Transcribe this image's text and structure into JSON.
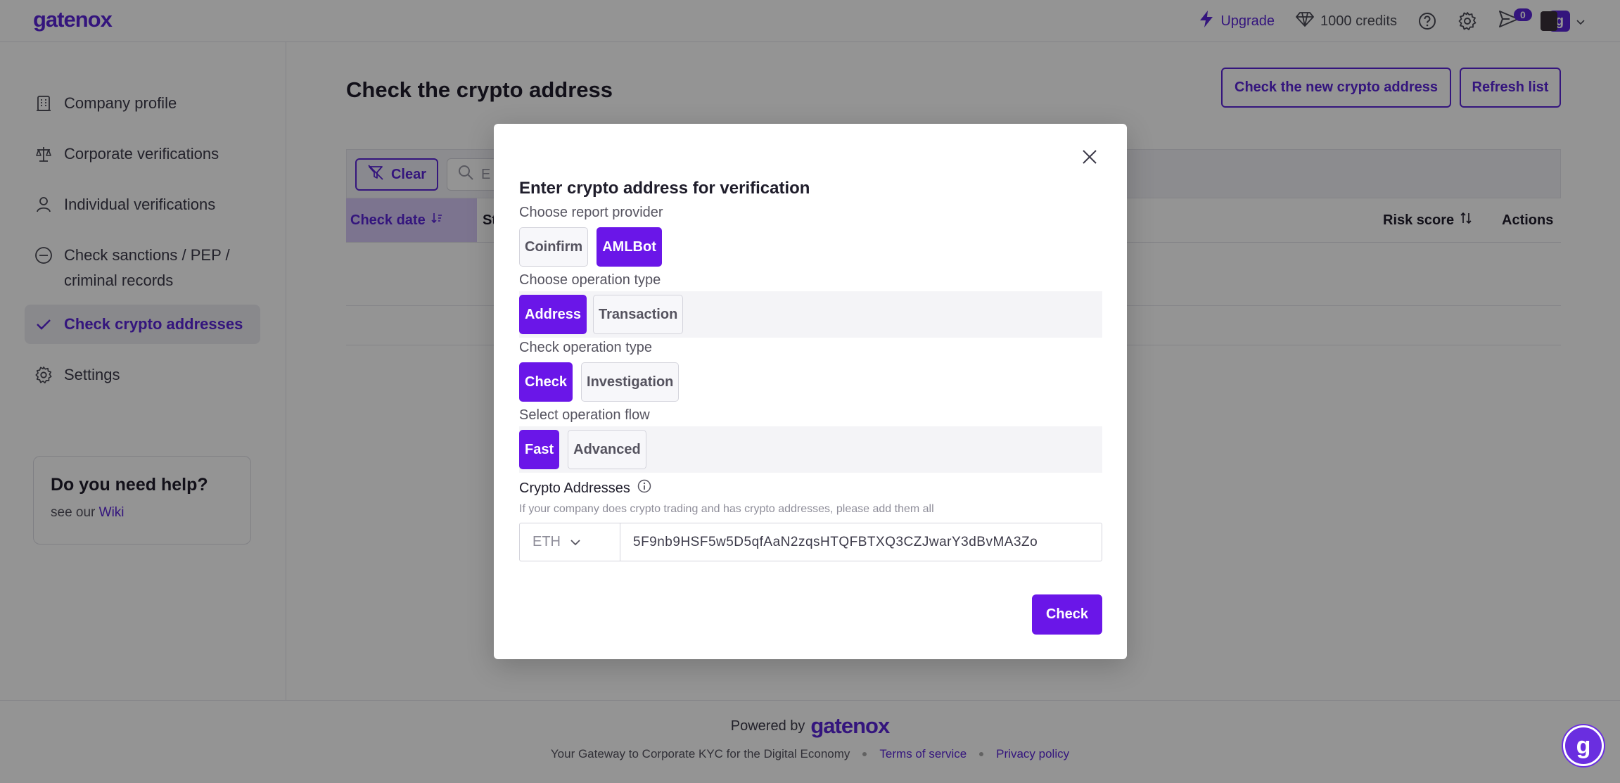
{
  "brand": {
    "logo": "gatenox",
    "accent": "#5a25d8"
  },
  "topnav": {
    "upgrade": "Upgrade",
    "credits": "1000 credits",
    "notifications_count": "0",
    "avatar_letter": "g"
  },
  "sidebar": {
    "items": [
      {
        "label": "Company profile",
        "icon": "building-icon"
      },
      {
        "label": "Corporate verifications",
        "icon": "scales-icon"
      },
      {
        "label": "Individual verifications",
        "icon": "user-icon"
      },
      {
        "label": "Check sanctions / PEP / criminal records",
        "icon": "minus-circle-icon"
      },
      {
        "label": "Check crypto addresses",
        "icon": "check-icon",
        "active": true
      },
      {
        "label": "Settings",
        "icon": "gear-icon"
      }
    ],
    "help": {
      "title": "Do you need help?",
      "text": "see our",
      "link": "Wiki"
    }
  },
  "main": {
    "title": "Check the crypto address",
    "new_button": "Check the new crypto address",
    "refresh_button": "Refresh list",
    "clear_button": "Clear",
    "search_placeholder": "E",
    "columns": {
      "check_date": "Check date",
      "status": "St",
      "risk_score": "Risk score",
      "actions": "Actions"
    }
  },
  "modal": {
    "title": "Enter crypto address for verification",
    "provider_label": "Choose report provider",
    "providers": [
      "Coinfirm",
      "AMLBot"
    ],
    "provider_selected": "AMLBot",
    "op_type_label": "Choose operation type",
    "op_types": [
      "Address",
      "Transaction"
    ],
    "op_type_selected": "Address",
    "check_type_label": "Check operation type",
    "check_types": [
      "Check",
      "Investigation"
    ],
    "check_type_selected": "Check",
    "flow_label": "Select operation flow",
    "flows": [
      "Fast",
      "Advanced"
    ],
    "flow_selected": "Fast",
    "addresses_label": "Crypto Addresses",
    "addresses_hint": "If your company does crypto trading and has crypto addresses, please add them all",
    "currency": "ETH",
    "address_value": "5F9nb9HSF5w5D5qfAaN2zqsHTQFBTXQ3CZJwarY3dBvMA3Zo",
    "submit": "Check"
  },
  "footer": {
    "powered_by": "Powered by",
    "logo": "gatenox",
    "tagline": "Your Gateway to Corporate KYC for the Digital Economy",
    "terms": "Terms of service",
    "privacy": "Privacy policy"
  },
  "chat": {
    "letter": "g"
  }
}
